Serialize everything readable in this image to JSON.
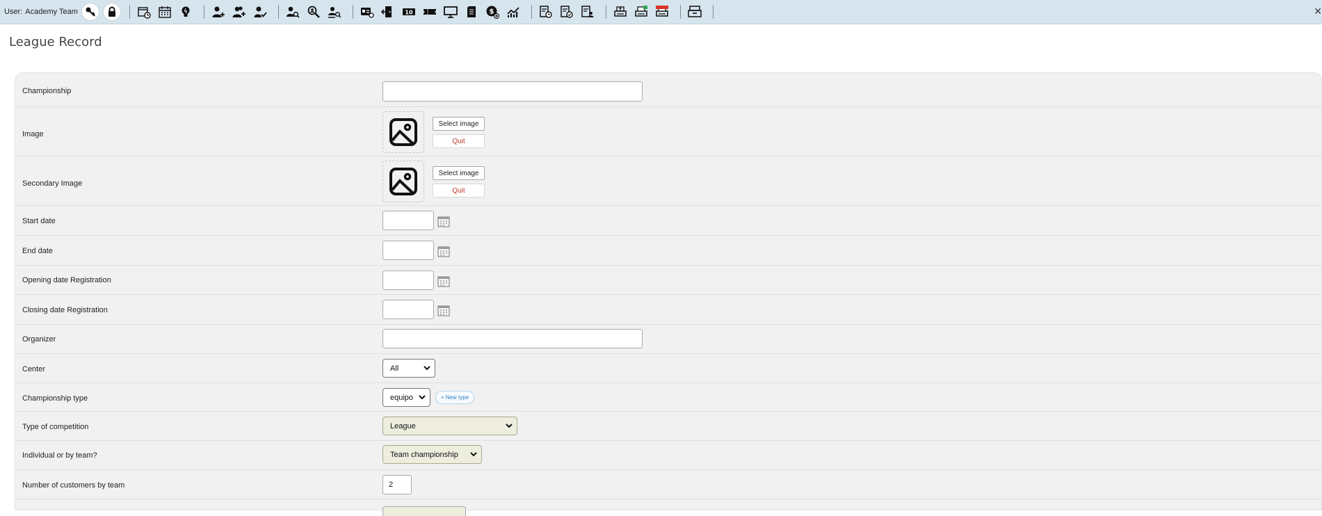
{
  "toolbar": {
    "user_label": "User:",
    "user_name": "Academy Team",
    "close": "✕",
    "icons": [
      "key-icon",
      "lock-icon",
      "calendar-clock-icon",
      "calendar-icon",
      "lightbulb-icon",
      "user-add-icon",
      "users-add-icon",
      "user-check-icon",
      "user-search-icon",
      "zoom-search-icon",
      "user-search-list-icon",
      "id-card-icon",
      "door-exit-icon",
      "badge-10-icon",
      "ticket-icon",
      "monitor-icon",
      "document-icon",
      "money-add-icon",
      "chart-line-icon",
      "report-clock-icon",
      "report-check-icon",
      "report-user-icon",
      "printer-up-icon",
      "printer-green-icon",
      "printer-red-icon",
      "drawer-icon"
    ]
  },
  "page": {
    "title": "League Record"
  },
  "form": {
    "championship": {
      "label": "Championship",
      "value": ""
    },
    "image": {
      "label": "Image",
      "select": "Select image",
      "quit": "Quit"
    },
    "secondary_image": {
      "label": "Secondary Image",
      "select": "Select image",
      "quit": "Quit"
    },
    "start_date": {
      "label": "Start date",
      "value": ""
    },
    "end_date": {
      "label": "End date",
      "value": ""
    },
    "opening_registration": {
      "label": "Opening date Registration",
      "value": ""
    },
    "closing_registration": {
      "label": "Closing date Registration",
      "value": ""
    },
    "organizer": {
      "label": "Organizer",
      "value": ""
    },
    "center": {
      "label": "Center",
      "selected": "All"
    },
    "championship_type": {
      "label": "Championship type",
      "selected": "equipo",
      "new_type": "+ New type"
    },
    "competition_type": {
      "label": "Type of competition",
      "selected": "League"
    },
    "individual_or_team": {
      "label": "Individual or by team?",
      "selected": "Team championship"
    },
    "customers_by_team": {
      "label": "Number of customers by team",
      "value": "2"
    }
  },
  "colors": {
    "toolbar_bg": "#d6e4ee",
    "panel_bg": "#f1f1f1",
    "quit_red": "#c0392b",
    "new_type_blue": "#2b7bc0"
  }
}
